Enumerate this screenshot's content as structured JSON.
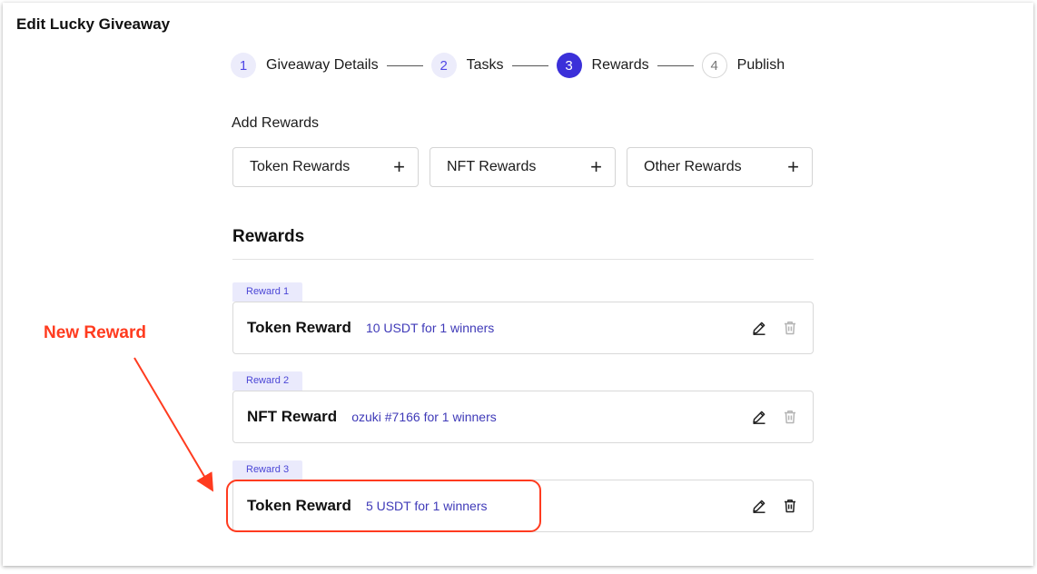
{
  "page": {
    "title": "Edit Lucky Giveaway"
  },
  "stepper": {
    "steps": [
      {
        "number": "1",
        "label": "Giveaway Details",
        "state": "done"
      },
      {
        "number": "2",
        "label": "Tasks",
        "state": "done"
      },
      {
        "number": "3",
        "label": "Rewards",
        "state": "active"
      },
      {
        "number": "4",
        "label": "Publish",
        "state": "todo"
      }
    ]
  },
  "add_rewards": {
    "title": "Add Rewards",
    "buttons": [
      {
        "label": "Token Rewards",
        "icon": "plus-icon"
      },
      {
        "label": "NFT Rewards",
        "icon": "plus-icon"
      },
      {
        "label": "Other Rewards",
        "icon": "plus-icon"
      }
    ]
  },
  "rewards": {
    "heading": "Rewards",
    "items": [
      {
        "tag": "Reward 1",
        "type": "Token Reward",
        "description": "10 USDT for 1 winners",
        "delete_enabled": false
      },
      {
        "tag": "Reward 2",
        "type": "NFT Reward",
        "description": "ozuki #7166 for 1 winners",
        "delete_enabled": false
      },
      {
        "tag": "Reward 3",
        "type": "Token Reward",
        "description": "5 USDT for 1 winners",
        "delete_enabled": true
      }
    ]
  },
  "annotation": {
    "label": "New Reward",
    "color": "#ff3b1f"
  },
  "colors": {
    "accent": "#3b30d9",
    "link_text": "#3f3ab8",
    "tag_bg": "#eaeafc"
  }
}
